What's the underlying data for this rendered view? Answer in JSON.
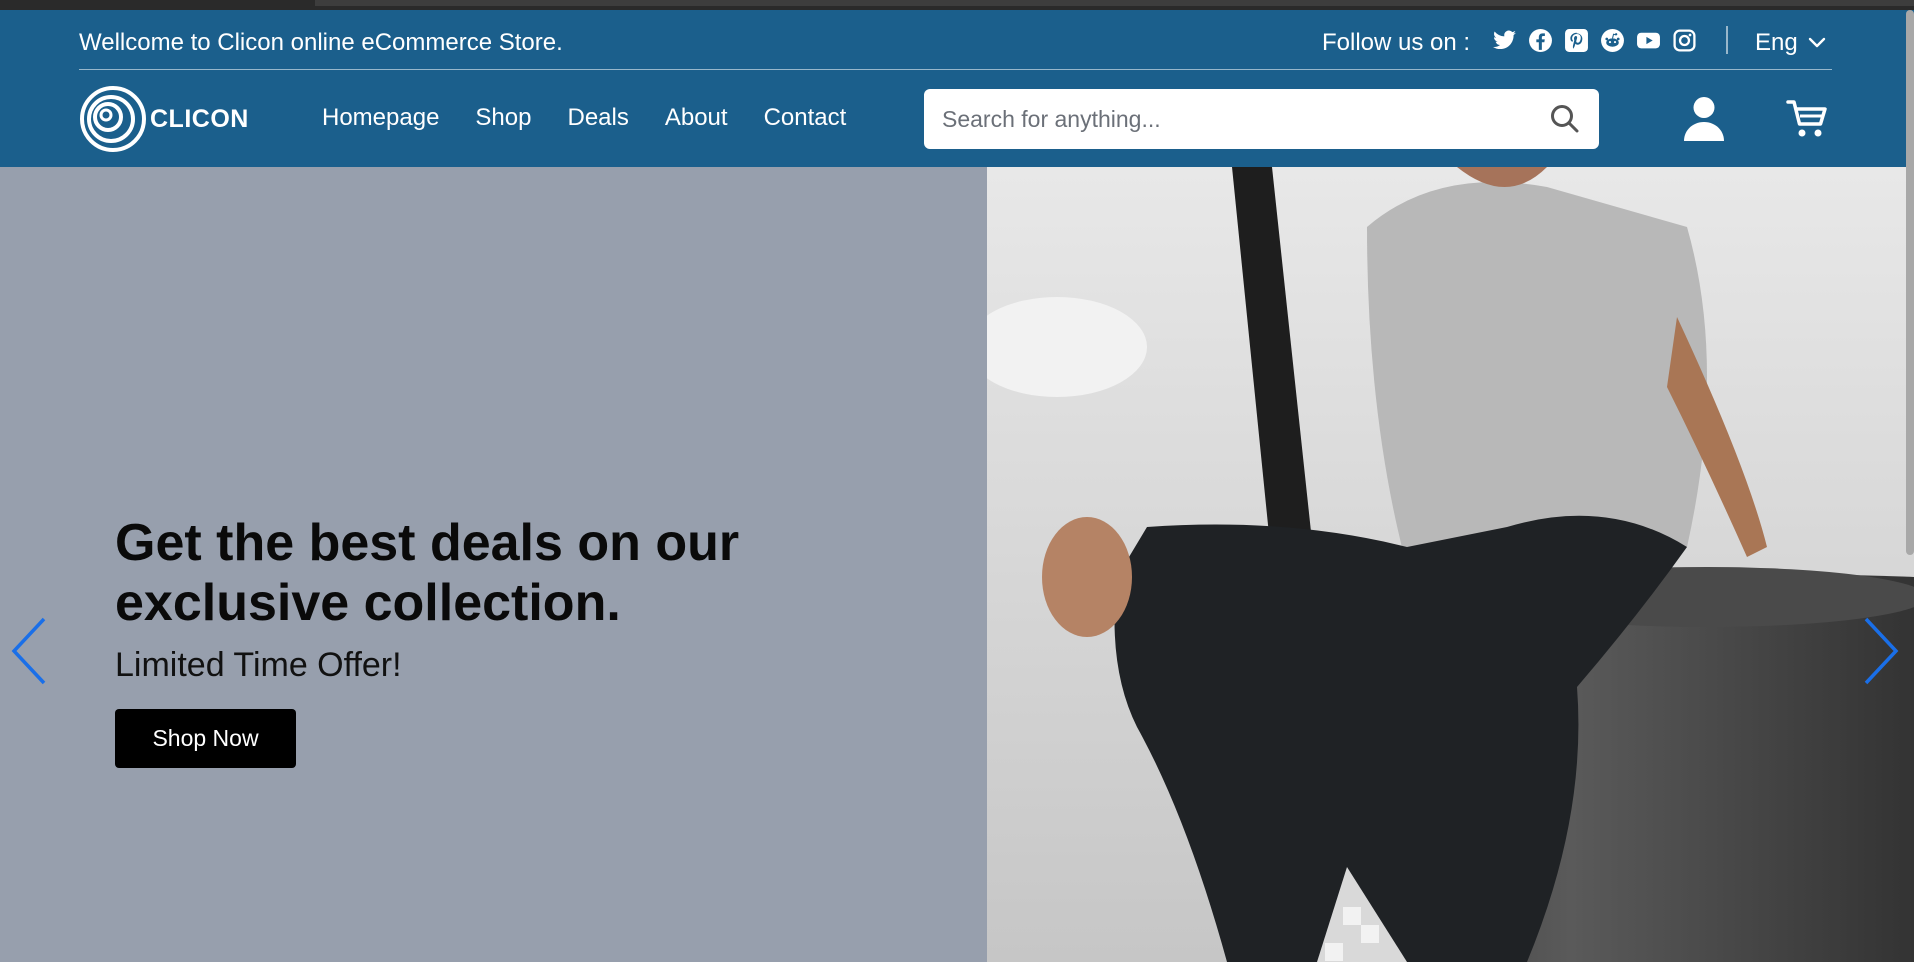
{
  "topbar": {
    "welcome": "Wellcome to Clicon online eCommerce Store.",
    "follow_label": "Follow us on :",
    "socials": [
      "twitter-icon",
      "facebook-icon",
      "pinterest-icon",
      "reddit-icon",
      "youtube-icon",
      "instagram-icon"
    ],
    "language": "Eng"
  },
  "brand": {
    "name": "CLICON"
  },
  "nav": {
    "items": [
      {
        "label": "Homepage"
      },
      {
        "label": "Shop"
      },
      {
        "label": "Deals"
      },
      {
        "label": "About"
      },
      {
        "label": "Contact"
      }
    ]
  },
  "search": {
    "placeholder": "Search for anything...",
    "value": ""
  },
  "hero": {
    "title": "Get the best deals on our exclusive collection.",
    "subtitle": "Limited Time Offer!",
    "cta": "Shop Now"
  },
  "colors": {
    "header_bg": "#1b5f8c",
    "hero_bg": "#979fad",
    "arrow": "#1a6fe8",
    "button_bg": "#000000"
  }
}
